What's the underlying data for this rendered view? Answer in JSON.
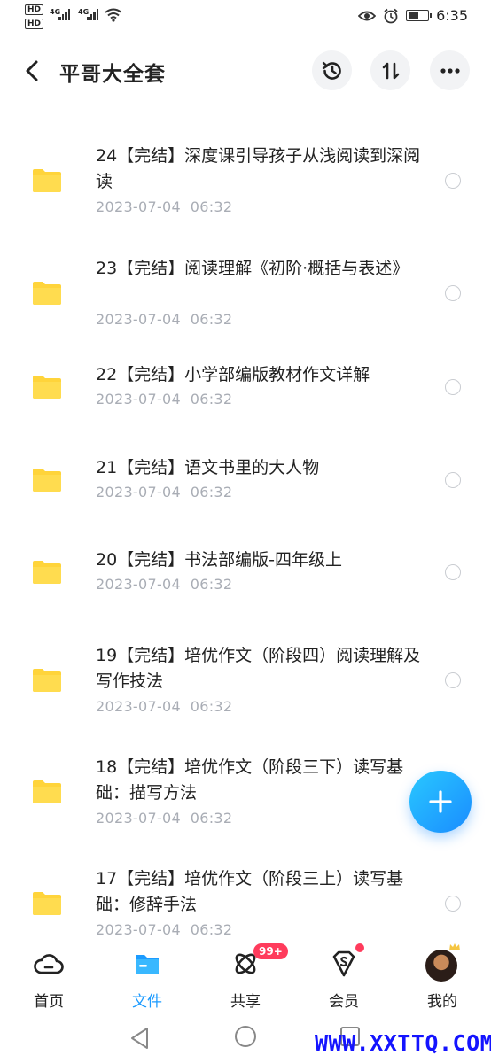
{
  "status_bar": {
    "sim1": "HD",
    "sim2": "HD",
    "net1": "4G",
    "net2": "4G",
    "time": "6:35",
    "battery_level": 0.55
  },
  "header": {
    "title": "平哥大全套"
  },
  "files": [
    {
      "name": "24【完结】深度课引导孩子从浅阅读到深阅读",
      "date": "2023-07-04  06:32"
    },
    {
      "name": "23【完结】阅读理解《初阶·概括与表述》",
      "date": "2023-07-04  06:32"
    },
    {
      "name": "22【完结】小学部编版教材作文详解",
      "date": "2023-07-04  06:32"
    },
    {
      "name": "21【完结】语文书里的大人物",
      "date": "2023-07-04  06:32"
    },
    {
      "name": "20【完结】书法部编版-四年级上",
      "date": "2023-07-04  06:32"
    },
    {
      "name": "19【完结】培优作文（阶段四）阅读理解及写作技法",
      "date": "2023-07-04  06:32"
    },
    {
      "name": "18【完结】培优作文（阶段三下）读写基础：描写方法",
      "date": "2023-07-04  06:32"
    },
    {
      "name": "17【完结】培优作文（阶段三上）读写基础：修辞手法",
      "date": "2023-07-04  06:32"
    }
  ],
  "bottom_nav": {
    "home": "首页",
    "files": "文件",
    "share": "共享",
    "share_badge": "99+",
    "member": "会员",
    "mine": "我的"
  },
  "watermark": "WWW.XXTTQ.COM",
  "colors": {
    "accent": "#1c9bff",
    "folder": "#ffd43b",
    "badge": "#ff3b5c",
    "date_text": "#a9adb5"
  }
}
